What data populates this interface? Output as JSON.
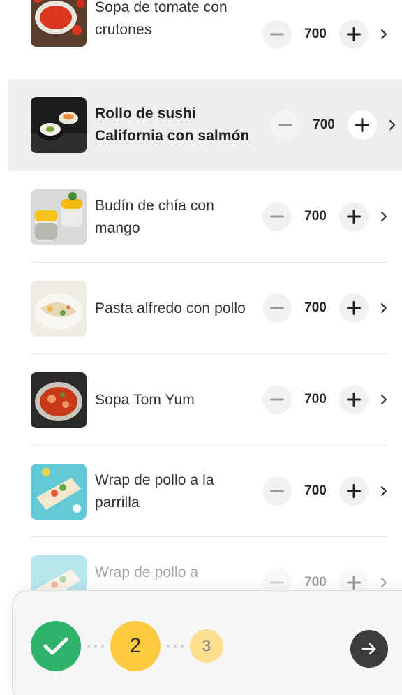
{
  "menu": {
    "items": [
      {
        "name": "Sopa de tomate con crutones",
        "qty": "700"
      },
      {
        "name": "Rollo de sushi California con salmón",
        "qty": "700"
      },
      {
        "name": "Budín de chía con mango",
        "qty": "700"
      },
      {
        "name": "Pasta alfredo con pollo",
        "qty": "700"
      },
      {
        "name": "Sopa Tom Yum",
        "qty": "700"
      },
      {
        "name": "Wrap de pollo a la parrilla",
        "qty": "700"
      },
      {
        "name": "Wrap de pollo a",
        "qty": "700"
      }
    ]
  },
  "progress": {
    "current_step": "2",
    "next_step": "3"
  },
  "colors": {
    "done": "#2fb36b",
    "active": "#fcca3e",
    "upcoming": "#fbdf8f",
    "next_button": "#3c3c3c",
    "selected_row": "#eeeeee"
  },
  "icons": [
    "minus-icon",
    "plus-icon",
    "chevron-right-icon",
    "check-icon",
    "arrow-right-icon"
  ]
}
